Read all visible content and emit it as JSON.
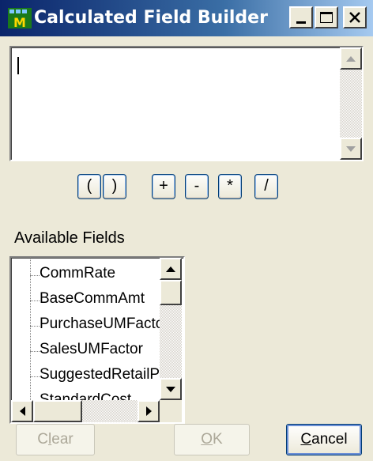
{
  "window": {
    "title": "Calculated Field Builder",
    "icon": "app-icon"
  },
  "expression": {
    "value": ""
  },
  "operators": [
    "(",
    ")",
    "+",
    "-",
    "*",
    "/"
  ],
  "available_fields": {
    "label": "Available Fields",
    "items": [
      "CommRate",
      "BaseCommAmt",
      "PurchaseUMFactor",
      "SalesUMFactor",
      "SuggestedRetailPrice",
      "StandardCost"
    ]
  },
  "buttons": {
    "clear_pre": "C",
    "clear_acc": "l",
    "clear_post": "ear",
    "ok_acc": "O",
    "ok_post": "K",
    "cancel_acc": "C",
    "cancel_post": "ancel"
  },
  "colors": {
    "titlebar_start": "#0a246a",
    "titlebar_end": "#a6caf0",
    "window_bg": "#ece9d8",
    "button_border": "#003c74"
  }
}
